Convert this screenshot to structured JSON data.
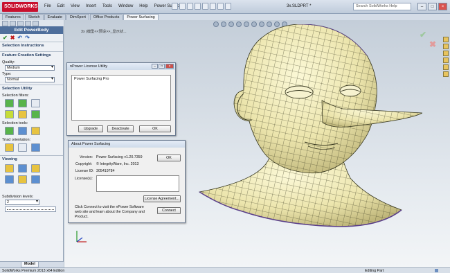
{
  "app": {
    "logo": "SOLIDWORKS",
    "document_title": "3x.SLDPRT *"
  },
  "menu": [
    "File",
    "Edit",
    "View",
    "Insert",
    "Tools",
    "Window",
    "Help",
    "Power Surfacing"
  ],
  "help_search": {
    "placeholder": "Search SolidWorks Help"
  },
  "command_tabs": [
    "Features",
    "Sketch",
    "Evaluate",
    "DimXpert",
    "Office Products",
    "Power Surfacing"
  ],
  "panel": {
    "title": "Edit PowerBody",
    "sections": {
      "selection_instructions": "Selection Instructions",
      "feature_creation_settings": "Feature Creation Settings",
      "quality_label": "Quality:",
      "quality_value": "Medium",
      "type_label": "Type:",
      "type_value": "Normal",
      "selection_utility": "Selection Utility",
      "selection_filters": "Selection filters:",
      "selection_tools": "Selection tools:",
      "triad_orientation": "Triad orientation:",
      "viewing": "Viewing",
      "subdivision_levels": "Subdivision levels:",
      "subdivision_value": "2"
    },
    "bottom_tab": "Model"
  },
  "viewport": {
    "breadcrumb": "3x (模型<<预设>>_显示状..."
  },
  "license_dialog": {
    "title": "nPower License Utility",
    "list_items": [
      "Power Surfacing Pro"
    ],
    "buttons": {
      "upgrade": "Upgrade",
      "deactivate": "Deactivate",
      "ok": "OK"
    }
  },
  "about_dialog": {
    "title": "About Power Surfacing",
    "version_label": "Version:",
    "version_value": "Power Surfacing v1.20.7359",
    "copyright_label": "Copyright:",
    "copyright_value": "© IntegrityWare, Inc. 2013",
    "license_id_label": "License ID:",
    "license_id_value": "305419784",
    "licenses_label": "License(s):",
    "buttons": {
      "ok": "OK",
      "license_agreement": "License Agreement...",
      "connect": "Connect"
    },
    "connect_text": "Click Connect to visit the nPower Software web site and learn about the Company and Product."
  },
  "status_bar": {
    "edition": "SolidWorks Premium 2013 x64 Edition",
    "state": "Editing Part"
  }
}
